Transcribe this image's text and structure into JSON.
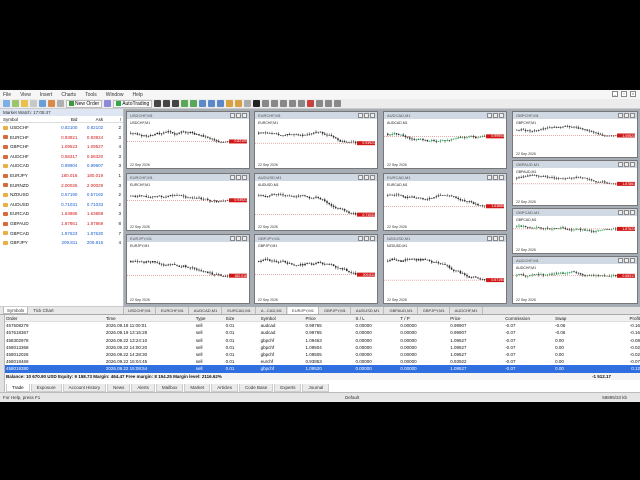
{
  "menu": [
    "File",
    "View",
    "Insert",
    "Charts",
    "Tools",
    "Window",
    "Help"
  ],
  "toolbar": {
    "new_order": "New Order",
    "autotrading": "AutoTrading"
  },
  "colors": {
    "bull": "#18a048",
    "bear": "#d01818",
    "accent": "#2f6fe0",
    "bg_dark": "#000000"
  },
  "market_watch": {
    "title": "Market Watch: 17:05:47",
    "headers": [
      "Symbol",
      "Bid",
      "Ask",
      "!"
    ],
    "rows": [
      {
        "symbol": "USDCHF",
        "bid": "0.82100",
        "ask": "0.82102",
        "spread": "2",
        "dir": "up"
      },
      {
        "symbol": "EURCHF",
        "bid": "0.93921",
        "ask": "0.93924",
        "spread": "3",
        "dir": "down"
      },
      {
        "symbol": "GBPCHF",
        "bid": "1.09523",
        "ask": "1.09527",
        "spread": "4",
        "dir": "down"
      },
      {
        "symbol": "AUDCHF",
        "bid": "0.58317",
        "ask": "0.58320",
        "spread": "3",
        "dir": "down"
      },
      {
        "symbol": "AUDCAD",
        "bid": "0.99904",
        "ask": "0.99907",
        "spread": "3",
        "dir": "up"
      },
      {
        "symbol": "EURJPY",
        "bid": "180.018",
        "ask": "180.019",
        "spread": "1",
        "dir": "down"
      },
      {
        "symbol": "EURNZD",
        "bid": "2.00026",
        "ask": "2.00029",
        "spread": "3",
        "dir": "down"
      },
      {
        "symbol": "NZDUSD",
        "bid": "0.57190",
        "ask": "0.57192",
        "spread": "2",
        "dir": "up"
      },
      {
        "symbol": "AUDUSD",
        "bid": "0.71031",
        "ask": "0.71033",
        "spread": "2",
        "dir": "up"
      },
      {
        "symbol": "EURCAD",
        "bid": "1.63885",
        "ask": "1.63888",
        "spread": "3",
        "dir": "down"
      },
      {
        "symbol": "GBPAUD",
        "bid": "1.87861",
        "ask": "1.87869",
        "spread": "8",
        "dir": "down"
      },
      {
        "symbol": "GBPCAD",
        "bid": "1.87623",
        "ask": "1.87630",
        "spread": "7",
        "dir": "up"
      },
      {
        "symbol": "GBPJPY",
        "bid": "209.811",
        "ask": "209.815",
        "spread": "4",
        "dir": "up"
      }
    ],
    "tabs": [
      "Symbols",
      "Tick Chart"
    ]
  },
  "charts": [
    {
      "title": "USDCHF,M1",
      "symbol": "USDCHF,M1",
      "date": "22 Sep 2026",
      "price": "0.82100",
      "dir": "bear"
    },
    {
      "title": "EURCHF,M1",
      "symbol": "EURCHF,M1",
      "date": "22 Sep 2026",
      "price": "0.93921",
      "dir": "bear"
    },
    {
      "title": "AUDCAD,M1",
      "symbol": "AUDCAD,M1",
      "date": "22 Sep 2026",
      "price": "0.99904",
      "dir": "mix"
    },
    {
      "title": "GBPCHF,M1",
      "symbol": "GBPCHF,M1",
      "date": "22 Sep 2026",
      "price": "1.09523",
      "dir": "bear"
    },
    {
      "title": "EURCHF,M1",
      "symbol": "EURCHF,M1",
      "date": "22 Sep 2026",
      "price": "0.93921",
      "dir": "bear"
    },
    {
      "title": "AUDUSD,M1",
      "symbol": "AUDUSD,M1",
      "date": "22 Sep 2026",
      "price": "0.71031",
      "dir": "bear"
    },
    {
      "title": "EURCAD,M1",
      "symbol": "EURCAD,M1",
      "date": "22 Sep 2026",
      "price": "1.63885",
      "dir": "bear"
    },
    {
      "title": "GBPAUD,M1",
      "symbol": "GBPAUD,M1",
      "date": "22 Sep 2026",
      "price": "1.87861",
      "dir": "bear"
    },
    {
      "title": "EURJPY,M1",
      "symbol": "EURJPY,M1",
      "date": "22 Sep 2026",
      "price": "180.018",
      "dir": "bear"
    },
    {
      "title": "GBPJPY,M1",
      "symbol": "GBPJPY,M1",
      "date": "22 Sep 2026",
      "price": "209.811",
      "dir": "bear"
    },
    {
      "title": "NZDUSD,M1",
      "symbol": "NZDUSD,M1",
      "date": "22 Sep 2026",
      "price": "0.57190",
      "dir": "bear"
    },
    {
      "title": "GBPCAD,M1",
      "symbol": "GBPCAD,M1",
      "date": "22 Sep 2026",
      "price": "1.87623",
      "dir": "mix"
    },
    {
      "title": "AUDCHF,M1",
      "symbol": "AUDCHF,M1",
      "date": "22 Sep 2026",
      "price": "0.58317",
      "dir": "mix"
    }
  ],
  "chart_tabs": [
    "USDCHF,M1",
    "EURCHF,M1",
    "AUDCAD,M1",
    "EURCAD,M1",
    "A...CAD,M1",
    "EURJPY,M1",
    "GBPJPY,M1",
    "AUDUSD,M1",
    "GBPAUD,M1",
    "GBPJPY,M1",
    "AUDCHF,M1"
  ],
  "terminal": {
    "headers": [
      "Order",
      "Time",
      "Type",
      "Size",
      "Symbol",
      "Price",
      "S / L",
      "T / P",
      "Price",
      "Commission",
      "Swap",
      "Profit"
    ],
    "rows": [
      {
        "cells": [
          "457508279",
          "2026.09.18 11:00:01",
          "sell",
          "0.01",
          "audcad",
          "0.99765",
          "0.00000",
          "0.00000",
          "0.99907",
          "-0.07",
          "-0.06",
          "-0.16"
        ],
        "selected": false
      },
      {
        "cells": [
          "457618367",
          "2026.09.19 13:15:28",
          "sell",
          "0.01",
          "audcad",
          "0.99765",
          "0.00000",
          "0.00000",
          "0.99907",
          "-0.07",
          "-0.06",
          "-0.16"
        ],
        "selected": false
      },
      {
        "cells": [
          "458302978",
          "2026.09.22 13:24:10",
          "sell",
          "0.01",
          "gbpchf",
          "1.09463",
          "0.00000",
          "0.00000",
          "1.09527",
          "-0.07",
          "0.00",
          "-0.08"
        ],
        "selected": false
      },
      {
        "cells": [
          "458013368",
          "2026.09.22 14:00:20",
          "sell",
          "0.01",
          "gbpchf",
          "1.09504",
          "0.00000",
          "0.00000",
          "1.09527",
          "-0.07",
          "0.00",
          "-0.02"
        ],
        "selected": false
      },
      {
        "cells": [
          "458012026",
          "2026.09.22 14:28:30",
          "sell",
          "0.01",
          "gbpchf",
          "1.09505",
          "0.00000",
          "0.00000",
          "1.09527",
          "-0.07",
          "0.00",
          "-0.02"
        ],
        "selected": false
      },
      {
        "cells": [
          "458018469",
          "2026.09.22 15:04:45",
          "sell",
          "0.01",
          "eurchf",
          "0.93853",
          "0.00000",
          "0.00000",
          "0.93922",
          "-0.07",
          "0.00",
          "-0.07"
        ],
        "selected": false
      },
      {
        "cells": [
          "458019380",
          "2026.09.22 15:08:54",
          "sell",
          "0.01",
          "gbpchf",
          "1.09520",
          "0.00000",
          "0.00000",
          "1.09527",
          "-0.07",
          "0.00",
          "0.12"
        ],
        "selected": true
      }
    ],
    "balance": "Balance: 10 670.90 USD  Equity: 9 158.73  Margin: 464.47  Free margin: 8 154.25  Margin level: 2116.62%",
    "balance_total": "-1 512.17",
    "tabs": [
      "Trade",
      "Exposure",
      "Account History",
      "News",
      "Alerts",
      "Mailbox",
      "Market",
      "Articles",
      "Code Base",
      "Experts",
      "Journal"
    ]
  },
  "status": {
    "help": "For Help, press F1",
    "profile": "Default",
    "conn": "58895/33 kb"
  }
}
